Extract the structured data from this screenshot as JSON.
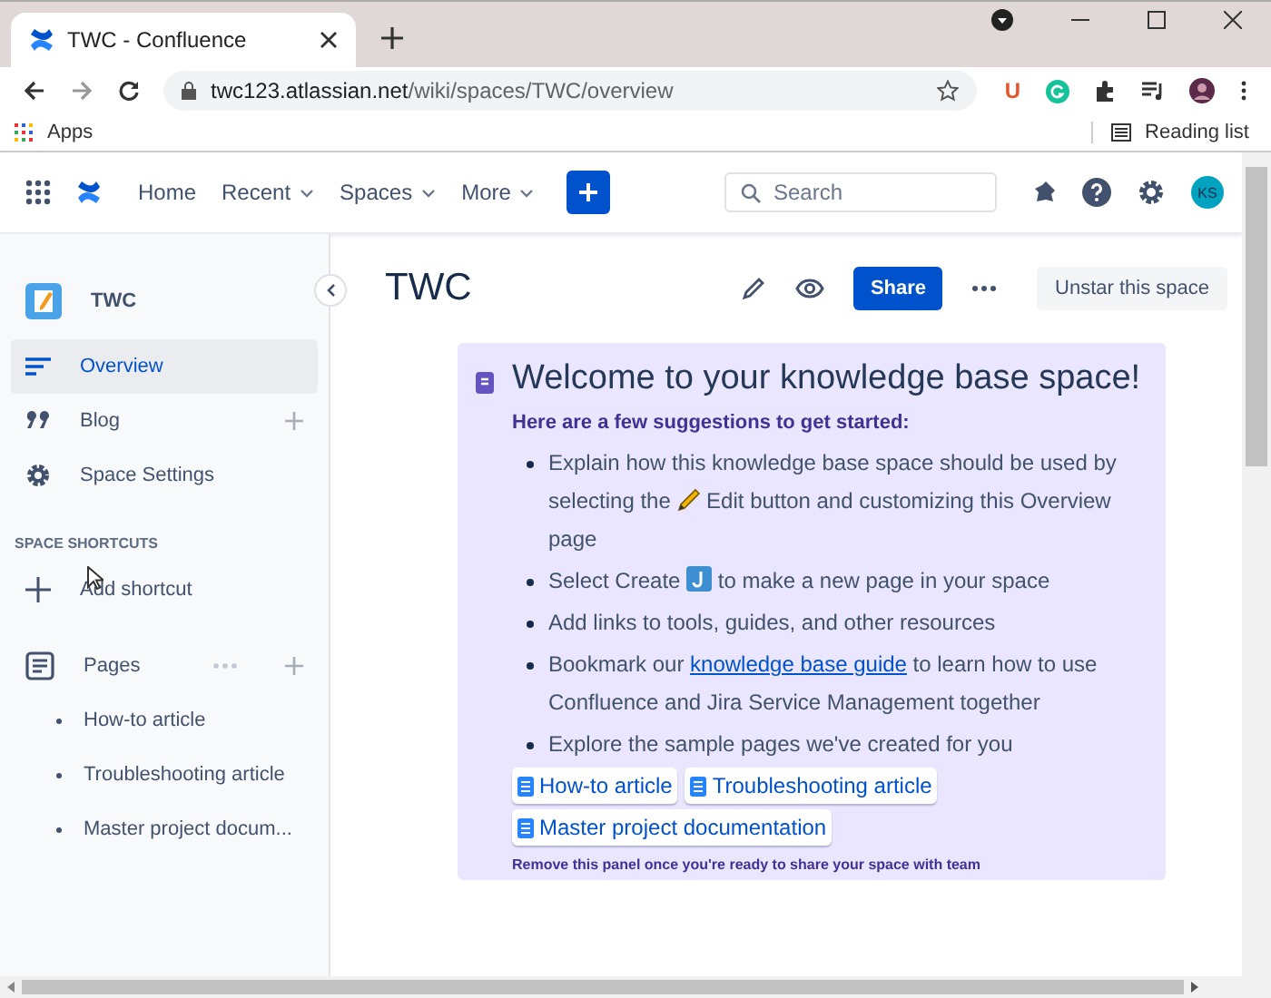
{
  "browser": {
    "tab_title": "TWC - Confluence",
    "url_host": "twc123.atlassian.net",
    "url_path": "/wiki/spaces/TWC/overview",
    "bookmarks": [
      {
        "label": "Apps"
      }
    ],
    "reading_list": "Reading list",
    "extension_badge": "U"
  },
  "header": {
    "nav": [
      {
        "label": "Home",
        "dropdown": false
      },
      {
        "label": "Recent",
        "dropdown": true
      },
      {
        "label": "Spaces",
        "dropdown": true
      },
      {
        "label": "More",
        "dropdown": true
      }
    ],
    "search": {
      "placeholder": "Search"
    },
    "avatar": "KS"
  },
  "sidebar": {
    "space_name": "TWC",
    "items": [
      {
        "label": "Overview",
        "kind": "overview",
        "selected": true,
        "addable": false
      },
      {
        "label": "Blog",
        "kind": "blog",
        "selected": false,
        "addable": true
      },
      {
        "label": "Space Settings",
        "kind": "settings",
        "selected": false,
        "addable": false
      }
    ],
    "shortcuts_heading": "SPACE SHORTCUTS",
    "add_shortcut": "Add shortcut",
    "pages_label": "Pages",
    "pages": [
      {
        "label": "How-to article"
      },
      {
        "label": "Troubleshooting article"
      },
      {
        "label": "Master project docum..."
      }
    ]
  },
  "page": {
    "title": "TWC",
    "share": "Share",
    "unstar": "Unstar this space",
    "panel": {
      "heading": "Welcome to your knowledge base space!",
      "intro": "Here are a few suggestions to get started:",
      "bullets": [
        [
          {
            "kind": "text",
            "text": "Explain how this knowledge base space should be used by selecting the "
          },
          {
            "kind": "pencil"
          },
          {
            "kind": "text",
            "text": " Edit button and customizing this Overview page"
          }
        ],
        [
          {
            "kind": "text",
            "text": "Select Create "
          },
          {
            "kind": "create"
          },
          {
            "kind": "text",
            "text": " to make a new page in your space"
          }
        ],
        [
          {
            "kind": "text",
            "text": "Add links to tools, guides, and other resources"
          }
        ],
        [
          {
            "kind": "text",
            "text": "Bookmark our "
          },
          {
            "kind": "link",
            "text": "knowledge base guide"
          },
          {
            "kind": "text",
            "text": " to learn how to use Confluence and Jira Service Management together"
          }
        ],
        [
          {
            "kind": "text",
            "text": "Explore the sample pages we've created for you"
          }
        ]
      ],
      "page_links": [
        {
          "label": "How-to article"
        },
        {
          "label": "Troubleshooting article"
        },
        {
          "label": "Master project documentation"
        }
      ],
      "note": "Remove this panel once you're ready to share your space with team"
    }
  }
}
